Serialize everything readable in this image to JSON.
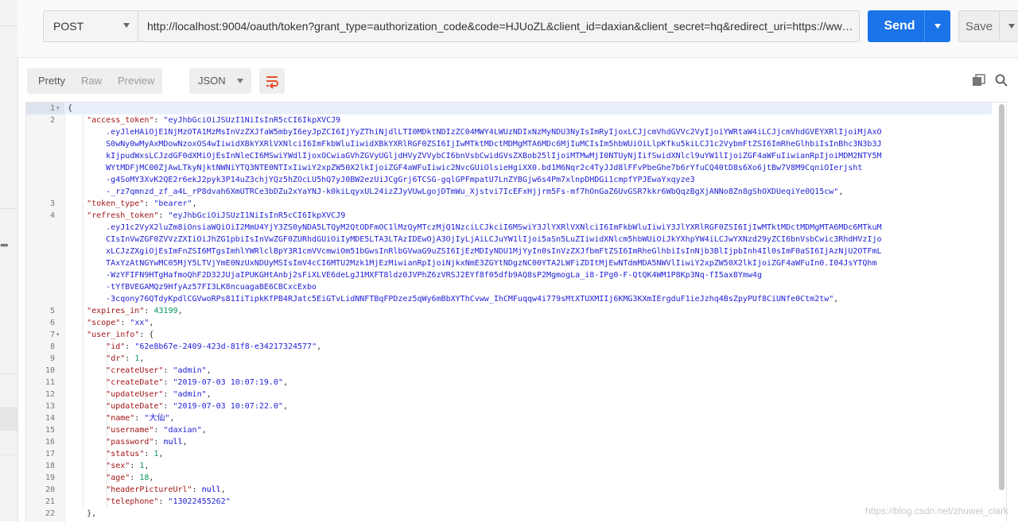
{
  "request": {
    "method": "POST",
    "url": "http://localhost:9004/oauth/token?grant_type=authorization_code&code=HJUoZL&client_id=daxian&client_secret=hq&redirect_uri=https://www.baidu.c...",
    "send_label": "Send",
    "save_label": "Save"
  },
  "response_toolbar": {
    "tabs": [
      "Pretty",
      "Raw",
      "Preview"
    ],
    "active_tab": "Pretty",
    "format": "JSON"
  },
  "watermark": "https://blog.csdn.net/zhuwei_clark",
  "lines": [
    {
      "n": "1",
      "parts": [
        {
          "c": "p",
          "t": "{"
        }
      ]
    },
    {
      "n": "2",
      "parts": [
        {
          "c": "p",
          "t": "    "
        },
        {
          "c": "k",
          "t": "\"access_token\""
        },
        {
          "c": "p",
          "t": ": "
        },
        {
          "c": "s",
          "t": "\"eyJhbGciOiJSUzI1NiIsInR5cCI6IkpXVCJ9"
        }
      ]
    },
    {
      "n": "",
      "parts": [
        {
          "c": "s",
          "t": "        .eyJleHAiOjE1NjMzOTA1MzMsInVzZXJfaW5mbyI6eyJpZCI6IjYyZThiNjdlLTI0MDktNDIzZC04MWY4LWUzNDIxNzMyNDU3NyIsImRyIjoxLCJjcmVhdGVVc2VyIjoiYWRtaW4iLCJjcmVhdGVEYXRlIjoiMjAxO"
        }
      ]
    },
    {
      "n": "",
      "parts": [
        {
          "c": "s",
          "t": "        S0wNy0wMyAxMDowNzoxOS4wIiwidXBkYXRlVXNlciI6ImFkbWluIiwidXBkYXRlRGF0ZSI6IjIwMTktMDctMDMgMTA6MDc6MjIuMCIsIm5hbWUiOiLlpKfku5kiLCJ1c2VybmFtZSI6ImRheGlhbiIsInBhc3N3b3J"
        }
      ]
    },
    {
      "n": "",
      "parts": [
        {
          "c": "s",
          "t": "        kIjpudWxsLCJzdGF0dXMiOjEsInNleCI6MSwiYWdlIjoxOCwiaGVhZGVyUGljdHVyZVVybCI6bnVsbCwidGVsZXBob25lIjoiMTMwMjI0NTUyNjIifSwidXNlcl9uYW1lIjoiZGF4aWFuIiwianRpIjoiMDM2NTY5M"
        }
      ]
    },
    {
      "n": "",
      "parts": [
        {
          "c": "s",
          "t": "        WYtMDFjMC00ZjAwLTkyNjktNWNiYTQ3NTE0NTIxIiwiY2xpZW50X2lkIjoiZGF4aWFuIiwic2NvcGUiOlsieHgiXX0.bd1M6Nqr2c4TyJJd8lFFvPbeGhe7b6rYfuCQ40tD8s6Xo6jtBw7V8M9CqniOIerjsht"
        }
      ]
    },
    {
      "n": "",
      "parts": [
        {
          "c": "s",
          "t": "        -g4SoMY3XvK2QE2r6ekJ2pyk3P14uZ3chjYQz5hZOcLU5hQ7yJ0BW2ezUiJCgGrj6TCSG-gqlGPFmpatU7LnZYBGjw6s4Pm7xlnpDHDGi1cmpfYPJEwaYxqyze3"
        }
      ]
    },
    {
      "n": "",
      "parts": [
        {
          "c": "s",
          "t": "        -_rz7qmnzd_zf_a4L_rP8dvah6XmUTRCe3bDZu2xYaYNJ-k0kiLqyxUL24izZJyVUwLgojDTmWu_Xjstvi7IcEFxHjjrm5Fs-mf7hOnGaZ6UvGSR7kkr6WbQqzBgXjANNo8Zn8gShOXDUeqiYe0Q15cw\""
        },
        {
          "c": "p",
          "t": ","
        }
      ]
    },
    {
      "n": "3",
      "parts": [
        {
          "c": "p",
          "t": "    "
        },
        {
          "c": "k",
          "t": "\"token_type\""
        },
        {
          "c": "p",
          "t": ": "
        },
        {
          "c": "s",
          "t": "\"bearer\""
        },
        {
          "c": "p",
          "t": ","
        }
      ]
    },
    {
      "n": "4",
      "parts": [
        {
          "c": "p",
          "t": "    "
        },
        {
          "c": "k",
          "t": "\"refresh_token\""
        },
        {
          "c": "p",
          "t": ": "
        },
        {
          "c": "s",
          "t": "\"eyJhbGciOiJSUzI1NiIsInR5cCI6IkpXVCJ9"
        }
      ]
    },
    {
      "n": "",
      "parts": [
        {
          "c": "s",
          "t": "        .eyJ1c2VyX2luZm8iOnsiaWQiOiI2MmU4YjY3ZS0yNDA5LTQyM2QtODFmOC1lMzQyMTczMjQ1NzciLCJkciI6MSwiY3JlYXRlVXNlciI6ImFkbWluIiwiY3JlYXRlRGF0ZSI6IjIwMTktMDctMDMgMTA6MDc6MTkuM"
        }
      ]
    },
    {
      "n": "",
      "parts": [
        {
          "c": "s",
          "t": "        CIsInVwZGF0ZVVzZXIiOiJhZG1pbiIsInVwZGF0ZURhdGUiOiIyMDE5LTA3LTAzIDEwOjA3OjIyLjAiLCJuYW1lIjoi5aSn5LuZIiwidXNlcm5hbWUiOiJkYXhpYW4iLCJwYXNzd29yZCI6bnVsbCwic3RhdHVzIjo"
        }
      ]
    },
    {
      "n": "",
      "parts": [
        {
          "c": "s",
          "t": "        xLCJzZXgiOjEsImFnZSI6MTgsImhlYWRlclBpY3R1cmVVcmwiOm51bGwsInRlbGVwaG9uZSI6IjEzMDIyNDU1MjYyIn0sInVzZXJfbmFtZSI6ImRheGlhbiIsInNjb3BlIjpbInh4Il0sImF0aSI6IjAzNjU2OTFmL"
        }
      ]
    },
    {
      "n": "",
      "parts": [
        {
          "c": "s",
          "t": "        TAxYzAtNGYwMC05MjY5LTVjYmE0NzUxNDUyMSIsImV4cCI6MTU2Mzk1MjEzMiwianRpIjoiNjkxNmE3ZGYtNDgzNC00YTA2LWFiZDItMjEwNTdmMDA5NWVlIiwiY2xpZW50X2lkIjoiZGF4aWFuIn0.I04JsYTQhm"
        }
      ]
    },
    {
      "n": "",
      "parts": [
        {
          "c": "s",
          "t": "        -WzYFIFN9HTgHafmoQhF2D32JUjaIPUKGHtAnbj2sFiXLVE6deLgJ1MXFT8ldz0JVPhZ6zVRSJ2EYf8f05dfb9AQ8sP2MgmogLa_i8-IPg0-F-QtQK4WM1P8Kp3Nq-fI5ax8Ymw4g"
        }
      ]
    },
    {
      "n": "",
      "parts": [
        {
          "c": "s",
          "t": "        -tYfBVEGAMQz9HfyAz57FI3LK8ncuagaBE6CBCxcExbo"
        }
      ]
    },
    {
      "n": "",
      "parts": [
        {
          "c": "s",
          "t": "        -3cqony76QTdyKpdlCGVwoRPs81IiTipkKfPB4RJatc5EiGTvLidNNFTBqFPDzez5qWy6mBbXYThCvww_IhCMFuqqw4i779sMtXTUXMIIj6KMG3KXmIErgduF1ieJzhq4BsZpyPUf8CiUNfe0Ctm2tw\""
        },
        {
          "c": "p",
          "t": ","
        }
      ]
    },
    {
      "n": "5",
      "parts": [
        {
          "c": "p",
          "t": "    "
        },
        {
          "c": "k",
          "t": "\"expires_in\""
        },
        {
          "c": "p",
          "t": ": "
        },
        {
          "c": "n",
          "t": "43199"
        },
        {
          "c": "p",
          "t": ","
        }
      ]
    },
    {
      "n": "6",
      "parts": [
        {
          "c": "p",
          "t": "    "
        },
        {
          "c": "k",
          "t": "\"scope\""
        },
        {
          "c": "p",
          "t": ": "
        },
        {
          "c": "s",
          "t": "\"xx\""
        },
        {
          "c": "p",
          "t": ","
        }
      ]
    },
    {
      "n": "7",
      "parts": [
        {
          "c": "p",
          "t": "    "
        },
        {
          "c": "k",
          "t": "\"user_info\""
        },
        {
          "c": "p",
          "t": ": {"
        }
      ]
    },
    {
      "n": "8",
      "parts": [
        {
          "c": "p",
          "t": "        "
        },
        {
          "c": "k",
          "t": "\"id\""
        },
        {
          "c": "p",
          "t": ": "
        },
        {
          "c": "s",
          "t": "\"62e8b67e-2409-423d-81f8-e34217324577\""
        },
        {
          "c": "p",
          "t": ","
        }
      ]
    },
    {
      "n": "9",
      "parts": [
        {
          "c": "p",
          "t": "        "
        },
        {
          "c": "k",
          "t": "\"dr\""
        },
        {
          "c": "p",
          "t": ": "
        },
        {
          "c": "n",
          "t": "1"
        },
        {
          "c": "p",
          "t": ","
        }
      ]
    },
    {
      "n": "10",
      "parts": [
        {
          "c": "p",
          "t": "        "
        },
        {
          "c": "k",
          "t": "\"createUser\""
        },
        {
          "c": "p",
          "t": ": "
        },
        {
          "c": "s",
          "t": "\"admin\""
        },
        {
          "c": "p",
          "t": ","
        }
      ]
    },
    {
      "n": "11",
      "parts": [
        {
          "c": "p",
          "t": "        "
        },
        {
          "c": "k",
          "t": "\"createDate\""
        },
        {
          "c": "p",
          "t": ": "
        },
        {
          "c": "s",
          "t": "\"2019-07-03 10:07:19.0\""
        },
        {
          "c": "p",
          "t": ","
        }
      ]
    },
    {
      "n": "12",
      "parts": [
        {
          "c": "p",
          "t": "        "
        },
        {
          "c": "k",
          "t": "\"updateUser\""
        },
        {
          "c": "p",
          "t": ": "
        },
        {
          "c": "s",
          "t": "\"admin\""
        },
        {
          "c": "p",
          "t": ","
        }
      ]
    },
    {
      "n": "13",
      "parts": [
        {
          "c": "p",
          "t": "        "
        },
        {
          "c": "k",
          "t": "\"updateDate\""
        },
        {
          "c": "p",
          "t": ": "
        },
        {
          "c": "s",
          "t": "\"2019-07-03 10:07:22.0\""
        },
        {
          "c": "p",
          "t": ","
        }
      ]
    },
    {
      "n": "14",
      "parts": [
        {
          "c": "p",
          "t": "        "
        },
        {
          "c": "k",
          "t": "\"name\""
        },
        {
          "c": "p",
          "t": ": "
        },
        {
          "c": "s",
          "t": "\"大仙\""
        },
        {
          "c": "p",
          "t": ","
        }
      ]
    },
    {
      "n": "15",
      "parts": [
        {
          "c": "p",
          "t": "        "
        },
        {
          "c": "k",
          "t": "\"username\""
        },
        {
          "c": "p",
          "t": ": "
        },
        {
          "c": "s",
          "t": "\"daxian\""
        },
        {
          "c": "p",
          "t": ","
        }
      ]
    },
    {
      "n": "16",
      "parts": [
        {
          "c": "p",
          "t": "        "
        },
        {
          "c": "k",
          "t": "\"password\""
        },
        {
          "c": "p",
          "t": ": "
        },
        {
          "c": "lit",
          "t": "null"
        },
        {
          "c": "p",
          "t": ","
        }
      ]
    },
    {
      "n": "17",
      "parts": [
        {
          "c": "p",
          "t": "        "
        },
        {
          "c": "k",
          "t": "\"status\""
        },
        {
          "c": "p",
          "t": ": "
        },
        {
          "c": "n",
          "t": "1"
        },
        {
          "c": "p",
          "t": ","
        }
      ]
    },
    {
      "n": "18",
      "parts": [
        {
          "c": "p",
          "t": "        "
        },
        {
          "c": "k",
          "t": "\"sex\""
        },
        {
          "c": "p",
          "t": ": "
        },
        {
          "c": "n",
          "t": "1"
        },
        {
          "c": "p",
          "t": ","
        }
      ]
    },
    {
      "n": "19",
      "parts": [
        {
          "c": "p",
          "t": "        "
        },
        {
          "c": "k",
          "t": "\"age\""
        },
        {
          "c": "p",
          "t": ": "
        },
        {
          "c": "n",
          "t": "18"
        },
        {
          "c": "p",
          "t": ","
        }
      ]
    },
    {
      "n": "20",
      "parts": [
        {
          "c": "p",
          "t": "        "
        },
        {
          "c": "k",
          "t": "\"headerPictureUrl\""
        },
        {
          "c": "p",
          "t": ": "
        },
        {
          "c": "lit",
          "t": "null"
        },
        {
          "c": "p",
          "t": ","
        }
      ]
    },
    {
      "n": "21",
      "parts": [
        {
          "c": "p",
          "t": "        "
        },
        {
          "c": "k",
          "t": "\"telephone\""
        },
        {
          "c": "p",
          "t": ": "
        },
        {
          "c": "s",
          "t": "\"13022455262\""
        }
      ]
    },
    {
      "n": "22",
      "parts": [
        {
          "c": "p",
          "t": "    },"
        }
      ]
    }
  ]
}
